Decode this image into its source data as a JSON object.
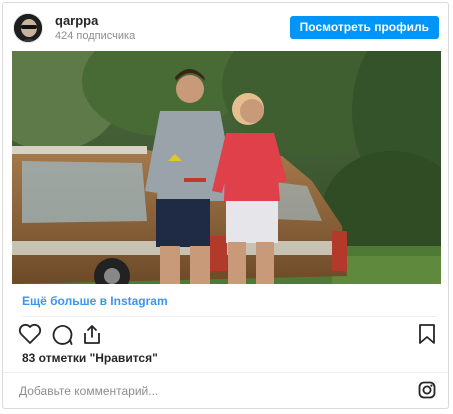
{
  "header": {
    "username": "qarppa",
    "followers": "424 подписчика",
    "view_profile_label": "Посмотреть профиль"
  },
  "post": {
    "image_icon": "post-photo",
    "more_link": "Ещё больше в Instagram",
    "likes_text": "83 отметки \"Нравится\"",
    "comment_placeholder": "Добавьте комментарий...",
    "actions": [
      "heart-icon",
      "comment-icon",
      "share-icon",
      "bookmark-icon"
    ],
    "footer_icon": "instagram-icon"
  },
  "colors": {
    "accent": "#0095f6",
    "link": "#3897f0",
    "muted": "#8e8e8e",
    "border": "#dbdbdb"
  }
}
